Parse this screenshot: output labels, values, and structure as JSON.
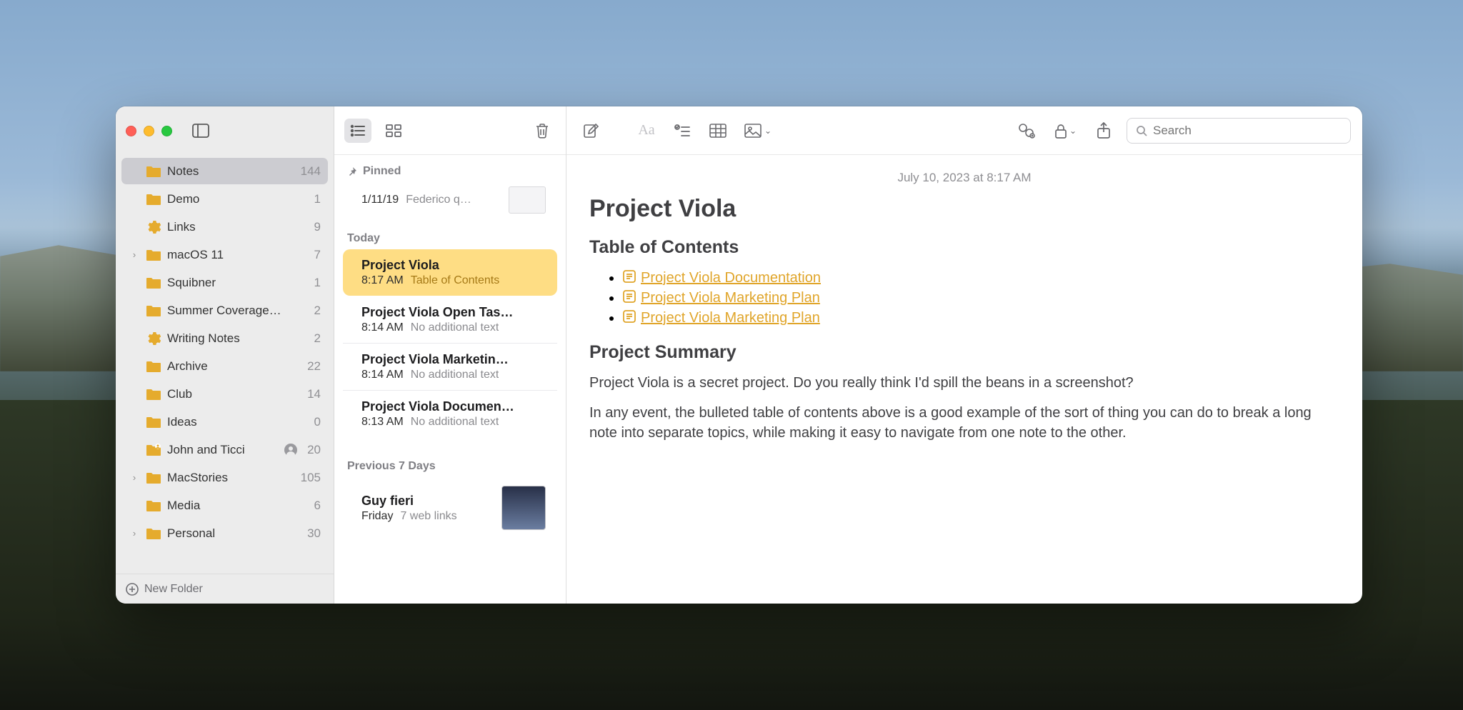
{
  "sidebar": {
    "new_folder": "New Folder",
    "folders": [
      {
        "name": "Notes",
        "count": "144",
        "icon": "folder",
        "selected": true,
        "expandable": false,
        "indent": 0
      },
      {
        "name": "Demo",
        "count": "1",
        "icon": "folder",
        "indent": 0
      },
      {
        "name": "Links",
        "count": "9",
        "icon": "gear",
        "indent": 0
      },
      {
        "name": "macOS 11",
        "count": "7",
        "icon": "folder",
        "expandable": true,
        "indent": 0
      },
      {
        "name": "Squibner",
        "count": "1",
        "icon": "folder",
        "indent": 0
      },
      {
        "name": "Summer Coverage…",
        "count": "2",
        "icon": "folder",
        "indent": 0
      },
      {
        "name": "Writing Notes",
        "count": "2",
        "icon": "gear",
        "indent": 0
      },
      {
        "name": "Archive",
        "count": "22",
        "icon": "folder",
        "indent": 0
      },
      {
        "name": "Club",
        "count": "14",
        "icon": "folder",
        "indent": 0
      },
      {
        "name": "Ideas",
        "count": "0",
        "icon": "folder",
        "indent": 0
      },
      {
        "name": "John and Ticci",
        "count": "20",
        "icon": "folder-shared",
        "shared": true,
        "indent": 0
      },
      {
        "name": "MacStories",
        "count": "105",
        "icon": "folder",
        "expandable": true,
        "indent": 0
      },
      {
        "name": "Media",
        "count": "6",
        "icon": "folder",
        "indent": 0
      },
      {
        "name": "Personal",
        "count": "30",
        "icon": "folder",
        "expandable": true,
        "indent": 0
      }
    ]
  },
  "notelist": {
    "pinned_label": "Pinned",
    "pinned": {
      "date": "1/11/19",
      "text": "Federico q…"
    },
    "today_label": "Today",
    "today": [
      {
        "title": "Project Viola",
        "time": "8:17 AM",
        "snippet": "Table of Contents",
        "selected": true
      },
      {
        "title": "Project Viola Open Tas…",
        "time": "8:14 AM",
        "snippet": "No additional text"
      },
      {
        "title": "Project Viola Marketin…",
        "time": "8:14 AM",
        "snippet": "No additional text"
      },
      {
        "title": "Project Viola Documen…",
        "time": "8:13 AM",
        "snippet": "No additional text"
      }
    ],
    "prev7_label": "Previous 7 Days",
    "prev7": [
      {
        "title": "Guy fieri",
        "time": "Friday",
        "snippet": "7 web links",
        "thumb": true
      }
    ]
  },
  "editor": {
    "search_placeholder": "Search",
    "date": "July 10, 2023 at 8:17 AM",
    "title": "Project Viola",
    "toc_heading": "Table of Contents",
    "links": [
      "Project Viola Documentation",
      "Project Viola Marketing Plan",
      "Project Viola Marketing Plan"
    ],
    "summary_heading": "Project Summary",
    "para1": "Project Viola is a secret project. Do you really think I'd spill the beans in a screenshot?",
    "para2": "In any event, the bulleted table of contents above is a good example of the sort of thing you can do to break a long note into separate topics, while making it easy to navigate from one note to the other."
  }
}
